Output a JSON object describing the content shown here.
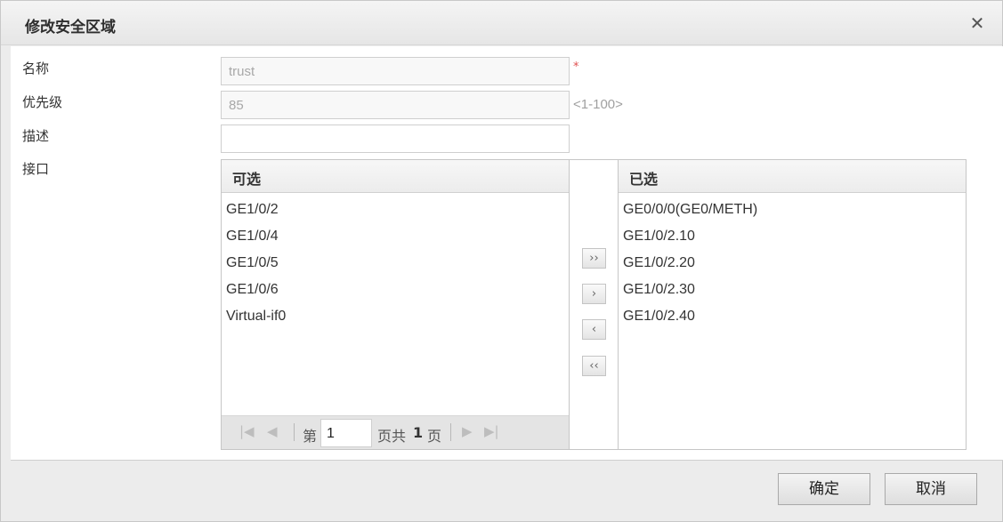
{
  "dialog": {
    "title": "修改安全区域",
    "close_glyph": "✕"
  },
  "form": {
    "name_label": "名称",
    "name_value": "trust",
    "required_mark": "*",
    "priority_label": "优先级",
    "priority_value": "85",
    "priority_hint": "<1-100>",
    "desc_label": "描述",
    "desc_value": "",
    "interface_label": "接口"
  },
  "available": {
    "header": "可选",
    "items": [
      "GE1/0/2",
      "GE1/0/4",
      "GE1/0/5",
      "GE1/0/6",
      "Virtual-if0"
    ],
    "pager": {
      "first_icon": "first-page-icon",
      "prev_icon": "prev-page-icon",
      "page_prefix": "第",
      "page_value": "1",
      "page_suffix": "页共",
      "total_pages": "1",
      "page_unit": "页",
      "next_icon": "next-page-icon",
      "last_icon": "last-page-icon"
    }
  },
  "selected": {
    "header": "已选",
    "items": [
      "GE0/0/0(GE0/METH)",
      "GE1/0/2.10",
      "GE1/0/2.20",
      "GE1/0/2.30",
      "GE1/0/2.40"
    ]
  },
  "move_buttons": {
    "add_all": "››",
    "add": "›",
    "remove": "‹",
    "remove_all": "‹‹"
  },
  "footer": {
    "ok_label": "确定",
    "cancel_label": "取消"
  }
}
